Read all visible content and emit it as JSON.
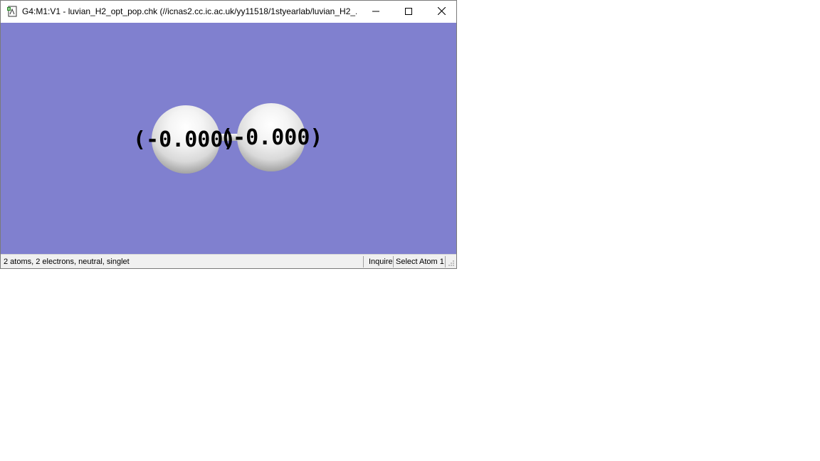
{
  "window": {
    "title": "G4:M1:V1 - luvian_H2_opt_pop.chk (//icnas2.cc.ic.ac.uk/yy11518/1styearlab/luvian_H2_...",
    "icon": "gaussview-document-icon"
  },
  "controls": {
    "minimize_icon": "minimize-icon",
    "maximize_icon": "maximize-icon",
    "close_icon": "close-icon"
  },
  "viewer": {
    "background_color": "#8080cf",
    "atoms": [
      {
        "element": "H",
        "charge_label": "(-0.000)"
      },
      {
        "element": "H",
        "charge_label": "(-0.000)"
      }
    ]
  },
  "status": {
    "summary": "2 atoms, 2 electrons, neutral, singlet",
    "mode": "Inquire",
    "action": "Select Atom 1"
  }
}
